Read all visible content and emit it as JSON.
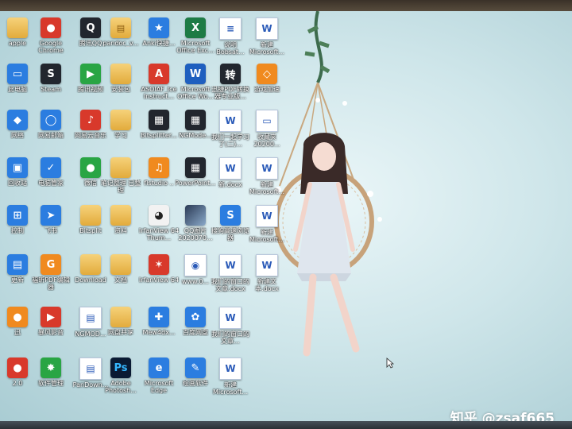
{
  "desktop": {
    "icons": [
      {
        "name": "icon-apple",
        "label": "apple",
        "glyph": "",
        "style": "folder"
      },
      {
        "name": "icon-google-chrome",
        "label": "Google Chrome",
        "glyph": "●",
        "style": "red"
      },
      {
        "name": "icon-tencent-qq",
        "label": "腾讯QQ",
        "glyph": "Q",
        "style": "dark"
      },
      {
        "name": "icon-pandoc",
        "label": "pandoc_v...",
        "glyph": "▤",
        "style": "folder"
      },
      {
        "name": "icon-anki",
        "label": "Anki快捷...",
        "glyph": "★",
        "style": "blue"
      },
      {
        "name": "icon-excel",
        "label": "Microsoft Office Exc...",
        "glyph": "X",
        "style": "excel"
      },
      {
        "name": "icon-doc-1",
        "label": "说明 Bobsat...",
        "glyph": "≡",
        "style": "doc"
      },
      {
        "name": "icon-doc-2",
        "label": "新建 Microsoft...",
        "glyph": "W",
        "style": "doc"
      },
      {
        "name": "icon-computer",
        "label": "此电脑",
        "glyph": "▭",
        "style": "blue"
      },
      {
        "name": "icon-steam",
        "label": "Steam",
        "glyph": "S",
        "style": "dark"
      },
      {
        "name": "icon-tencent-video",
        "label": "腾讯视频",
        "glyph": "▶",
        "style": "green"
      },
      {
        "name": "icon-folder-anzhuang",
        "label": "安装包",
        "glyph": "",
        "style": "folder"
      },
      {
        "name": "icon-asoiaf",
        "label": "ASOIAF_Ice Instruct...",
        "glyph": "A",
        "style": "red"
      },
      {
        "name": "icon-word",
        "label": "Microsoft Office Wo...",
        "glyph": "W",
        "style": "word"
      },
      {
        "name": "icon-converter",
        "label": "迅捷PDF转换器专业版...",
        "glyph": "转",
        "style": "dark"
      },
      {
        "name": "icon-game-center",
        "label": "游戏加速",
        "glyph": "◇",
        "style": "orange"
      },
      {
        "name": "icon-network",
        "label": "网络",
        "glyph": "◆",
        "style": "blue"
      },
      {
        "name": "icon-browser",
        "label": "网易邮箱",
        "glyph": "◯",
        "style": "blue"
      },
      {
        "name": "icon-netease-music",
        "label": "网易云音乐",
        "glyph": "♪",
        "style": "red"
      },
      {
        "name": "icon-folder-study",
        "label": "学习",
        "glyph": "",
        "style": "folder"
      },
      {
        "name": "icon-bitsplitter",
        "label": "Bitsplitter...",
        "glyph": "▦",
        "style": "dark"
      },
      {
        "name": "icon-nomodel",
        "label": "NGMode...",
        "glyph": "▦",
        "style": "dark"
      },
      {
        "name": "icon-doc-3",
        "label": "我们一起学习了(二)...",
        "glyph": "W",
        "style": "doc"
      },
      {
        "name": "icon-doc-4",
        "label": "收藏夹 20200...",
        "glyph": "▭",
        "style": "doc"
      },
      {
        "name": "icon-recycle",
        "label": "回收站",
        "glyph": "▣",
        "style": "blue"
      },
      {
        "name": "icon-security",
        "label": "电脑管家",
        "glyph": "✓",
        "style": "blue"
      },
      {
        "name": "icon-wechat",
        "label": "微信",
        "glyph": "●",
        "style": "green"
      },
      {
        "name": "icon-folder-notes",
        "label": "笔记整理 已整理",
        "glyph": "",
        "style": "folder"
      },
      {
        "name": "icon-fstudio",
        "label": "flstudio ..",
        "glyph": "♫",
        "style": "orange"
      },
      {
        "name": "icon-ppt",
        "label": "PowerPoint...",
        "glyph": "▦",
        "style": "dark"
      },
      {
        "name": "icon-doc-5",
        "label": "新.docx",
        "glyph": "W",
        "style": "doc"
      },
      {
        "name": "icon-doc-6",
        "label": "新建 Microsoft...",
        "glyph": "W",
        "style": "doc"
      },
      {
        "name": "icon-control",
        "label": "控制",
        "glyph": "⊞",
        "style": "blue"
      },
      {
        "name": "icon-feishu",
        "label": "飞书",
        "glyph": "➤",
        "style": "blue"
      },
      {
        "name": "icon-folder-bitsplit",
        "label": "Bitsplit",
        "glyph": "",
        "style": "folder"
      },
      {
        "name": "icon-folder-data",
        "label": "资料",
        "glyph": "",
        "style": "folder"
      },
      {
        "name": "icon-irfanview",
        "label": "IrfanView 64 Thum...",
        "glyph": "◕",
        "style": "panda"
      },
      {
        "name": "icon-screenshot",
        "label": "QQ图片2020070...",
        "glyph": "",
        "style": "photo"
      },
      {
        "name": "icon-sogou",
        "label": "搜狗高速浏览器",
        "glyph": "S",
        "style": "blue"
      },
      {
        "name": "icon-doc-7",
        "label": "新建 Microsoft...",
        "glyph": "W",
        "style": "doc"
      },
      {
        "name": "icon-update",
        "label": "更新",
        "glyph": "▤",
        "style": "blue"
      },
      {
        "name": "icon-pdf-tool",
        "label": "福昕PDF编辑器",
        "glyph": "G",
        "style": "orange"
      },
      {
        "name": "icon-folder-download",
        "label": "Download",
        "glyph": "",
        "style": "folder"
      },
      {
        "name": "icon-folder-docs",
        "label": "文档",
        "glyph": "",
        "style": "folder"
      },
      {
        "name": "icon-irfanview-64",
        "label": "IrfanView 64",
        "glyph": "✶",
        "style": "red"
      },
      {
        "name": "icon-www",
        "label": "www.0...",
        "glyph": "◉",
        "style": "doc"
      },
      {
        "name": "icon-doc-8",
        "label": "我们的窗口的文章.docx",
        "glyph": "W",
        "style": "doc"
      },
      {
        "name": "icon-doc-9",
        "label": "新建文本.docx",
        "glyph": "W",
        "style": "doc"
      },
      {
        "name": "icon-app-8",
        "label": "迅",
        "glyph": "●",
        "style": "orange"
      },
      {
        "name": "icon-media-player",
        "label": "暴风影音",
        "glyph": "▶",
        "style": "red"
      },
      {
        "name": "icon-nomo-doc",
        "label": "NGMOD...",
        "glyph": "▤",
        "style": "doc"
      },
      {
        "name": "icon-folder-network",
        "label": "网盘共享",
        "glyph": "",
        "style": "folder"
      },
      {
        "name": "icon-mewpix",
        "label": "Mew4dx...",
        "glyph": "✚",
        "style": "blue"
      },
      {
        "name": "icon-mobile-assistant",
        "label": "百度网盘",
        "glyph": "✿",
        "style": "blue"
      },
      {
        "name": "icon-doc-10",
        "label": "我们的窗口的文章...",
        "glyph": "W",
        "style": "doc"
      },
      {
        "name": "icon-app-9",
        "label": "2.0",
        "glyph": "●",
        "style": "red"
      },
      {
        "name": "icon-app-store",
        "label": "软件管理",
        "glyph": "✸",
        "style": "green"
      },
      {
        "name": "icon-pandownload",
        "label": "PanDown...",
        "glyph": "▤",
        "style": "doc"
      },
      {
        "name": "icon-photoshop",
        "label": "Adobe Photosh...",
        "glyph": "Ps",
        "style": "ps"
      },
      {
        "name": "icon-edge",
        "label": "Microsoft Edge",
        "glyph": "e",
        "style": "blue"
      },
      {
        "name": "icon-draw",
        "label": "绘画软件",
        "glyph": "✎",
        "style": "blue"
      },
      {
        "name": "icon-doc-11",
        "label": "新建 Microsoft...",
        "glyph": "W",
        "style": "doc"
      },
      {
        "name": "icon-doc-12",
        "label": "新建 Microsoft...",
        "glyph": "W",
        "style": "doc"
      }
    ]
  },
  "watermark": "知乎 @zsaf665"
}
